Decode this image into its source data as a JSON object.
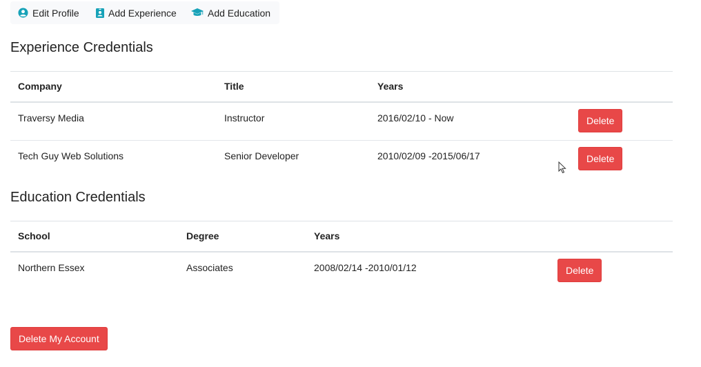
{
  "dashboard": {
    "edit_profile": "Edit Profile",
    "add_experience": "Add Experience",
    "add_education": "Add Education",
    "icon_color": "#17a2b8"
  },
  "experience": {
    "heading": "Experience Credentials",
    "columns": [
      "Company",
      "Title",
      "Years"
    ],
    "rows": [
      {
        "company": "Traversy Media",
        "title": "Instructor",
        "years": "2016/02/10 - Now",
        "action": "Delete"
      },
      {
        "company": "Tech Guy Web Solutions",
        "title": "Senior Developer",
        "years": "2010/02/09 -2015/06/17",
        "action": "Delete"
      }
    ]
  },
  "education": {
    "heading": "Education Credentials",
    "columns": [
      "School",
      "Degree",
      "Years"
    ],
    "rows": [
      {
        "school": "Northern Essex",
        "degree": "Associates",
        "years": "2008/02/14 -2010/01/12",
        "action": "Delete"
      }
    ]
  },
  "account": {
    "delete_label": "Delete My Account"
  },
  "colors": {
    "danger": "#e84848",
    "accent": "#17a2b8"
  }
}
